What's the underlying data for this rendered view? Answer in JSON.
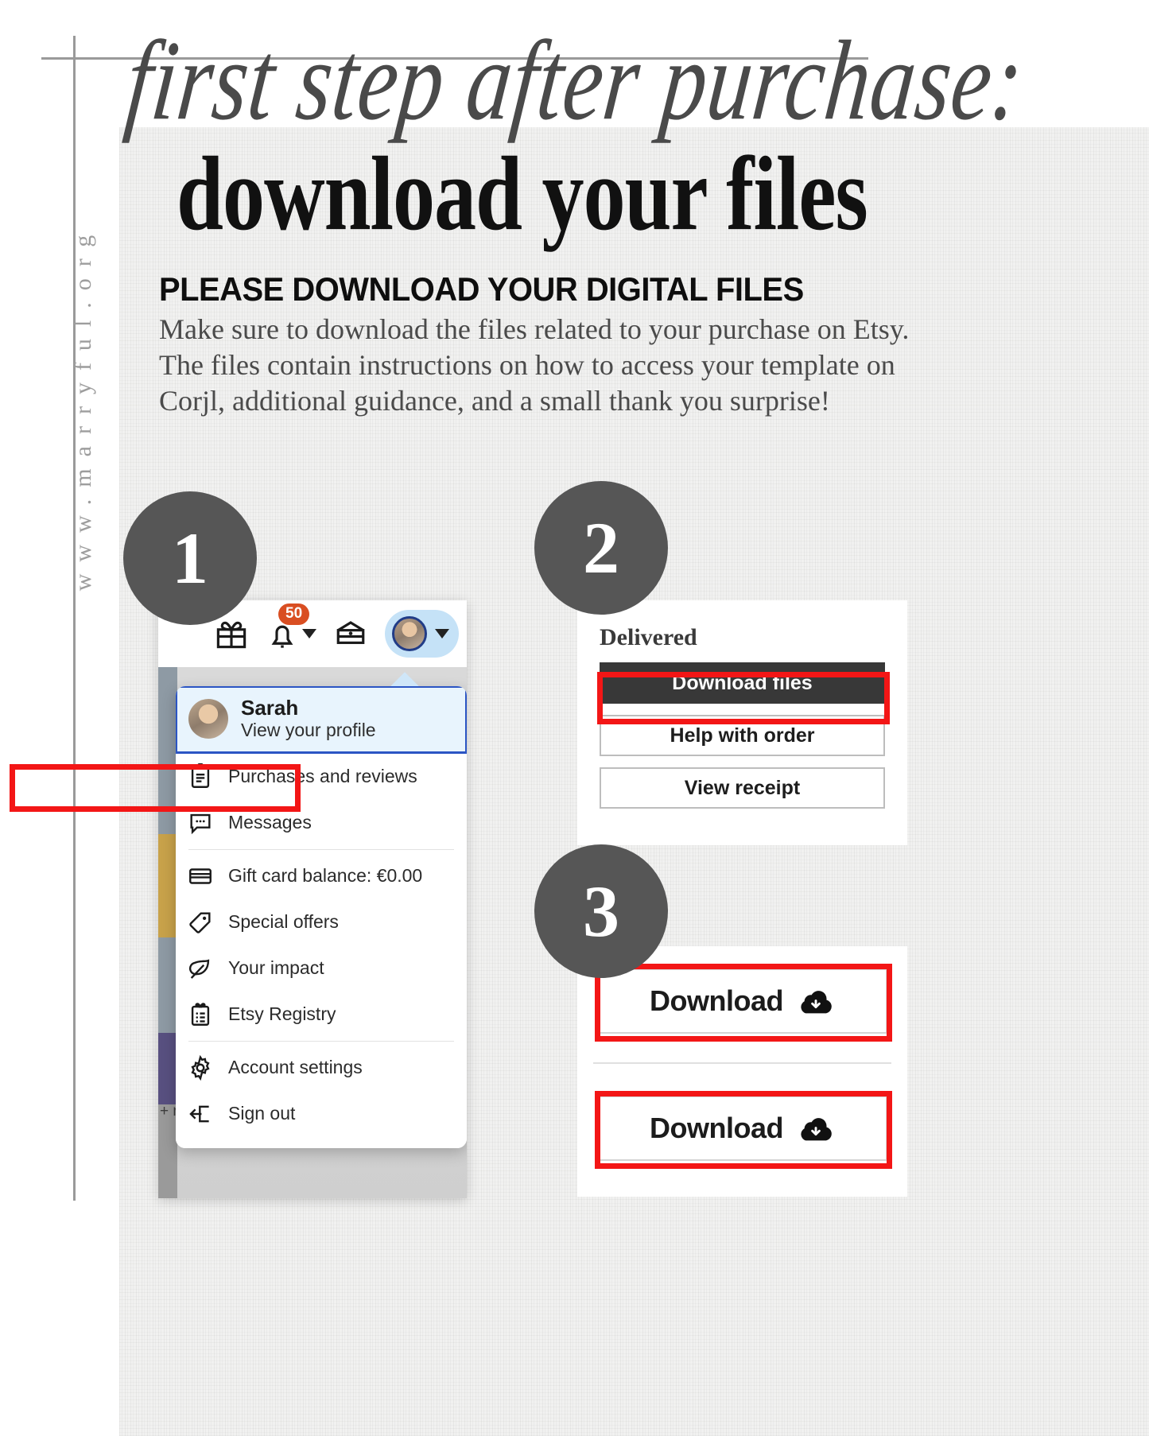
{
  "branding": {
    "url": "www.marryful.org"
  },
  "header": {
    "script_line": "first step after purchase:",
    "title": "download your files",
    "subhead": "PLEASE DOWNLOAD YOUR DIGITAL FILES",
    "paragraph": "Make sure to download the files related to your purchase on Etsy. The files contain instructions on how to access your template on Corjl, additional guidance, and a small thank you surprise!"
  },
  "steps": {
    "one": "1",
    "two": "2",
    "three": "3"
  },
  "step1": {
    "topbar": {
      "gift_icon": "gift-icon",
      "bell_icon": "bell-icon",
      "notification_count": "50",
      "shop_icon": "shop-icon",
      "avatar_icon": "avatar-icon",
      "caret_icon": "chevron-down-icon"
    },
    "profile": {
      "name": "Sarah",
      "subtitle": "View your profile"
    },
    "menu": [
      {
        "label": "Purchases and reviews",
        "icon": "clipboard-icon",
        "highlighted": true
      },
      {
        "label": "Messages",
        "icon": "chat-bubble-icon",
        "highlighted": false
      },
      {
        "label": "Gift card balance: €0.00",
        "icon": "credit-card-icon",
        "highlighted": false
      },
      {
        "label": "Special offers",
        "icon": "tag-icon",
        "highlighted": false
      },
      {
        "label": "Your impact",
        "icon": "leaf-icon",
        "highlighted": false
      },
      {
        "label": "Etsy Registry",
        "icon": "registry-clipboard-icon",
        "highlighted": false
      },
      {
        "label": "Account settings",
        "icon": "gear-icon",
        "highlighted": false
      },
      {
        "label": "Sign out",
        "icon": "sign-out-icon",
        "highlighted": false
      }
    ],
    "background_text": "+ n"
  },
  "step2": {
    "status": "Delivered",
    "buttons": [
      {
        "label": "Download files",
        "style": "dark",
        "highlighted": true
      },
      {
        "label": "Help with order",
        "style": "light",
        "highlighted": false
      },
      {
        "label": "View receipt",
        "style": "light",
        "highlighted": false
      }
    ]
  },
  "step3": {
    "buttons": [
      {
        "label": "Download",
        "icon": "cloud-download-icon",
        "highlighted": true
      },
      {
        "label": "Download",
        "icon": "cloud-download-icon",
        "highlighted": true
      }
    ]
  },
  "colors": {
    "badge_gray": "#565656",
    "highlight_red": "#f31616",
    "etsy_orange": "#d94e22",
    "profile_blue": "#2b55c4",
    "dark_button": "#383838"
  }
}
